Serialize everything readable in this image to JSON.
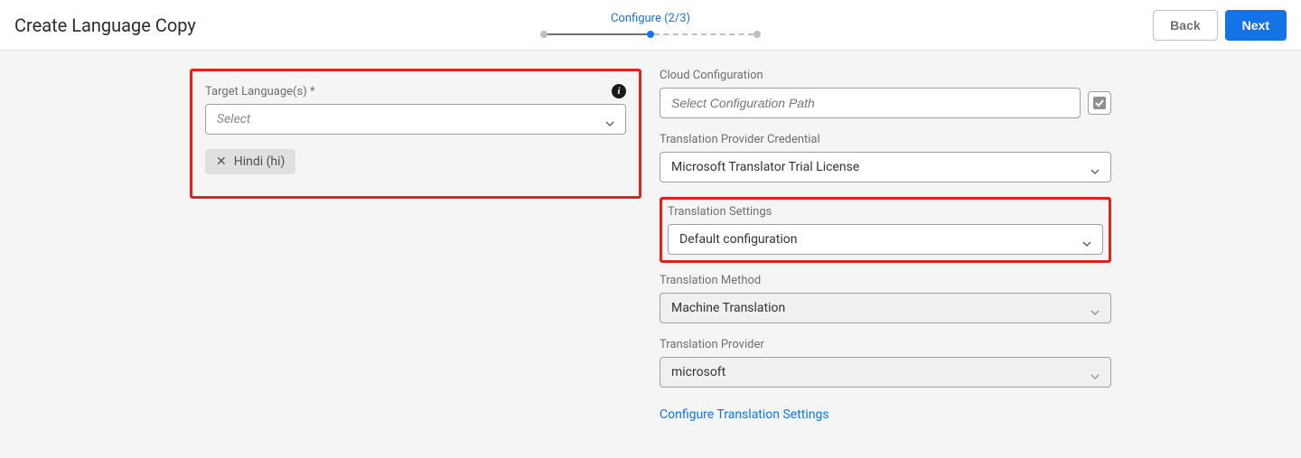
{
  "header": {
    "title": "Create Language Copy",
    "stepper_label": "Configure (2/3)",
    "back_label": "Back",
    "next_label": "Next"
  },
  "left": {
    "target_lang_label": "Target Language(s) *",
    "target_lang_placeholder": "Select",
    "chip_label": "Hindi (hi)"
  },
  "right": {
    "cloud_config_label": "Cloud Configuration",
    "cloud_config_placeholder": "Select Configuration Path",
    "provider_cred_label": "Translation Provider Credential",
    "provider_cred_value": "Microsoft Translator Trial License",
    "trans_settings_label": "Translation Settings",
    "trans_settings_value": "Default configuration",
    "trans_method_label": "Translation Method",
    "trans_method_value": "Machine Translation",
    "trans_provider_label": "Translation Provider",
    "trans_provider_value": "microsoft",
    "configure_link": "Configure Translation Settings"
  }
}
